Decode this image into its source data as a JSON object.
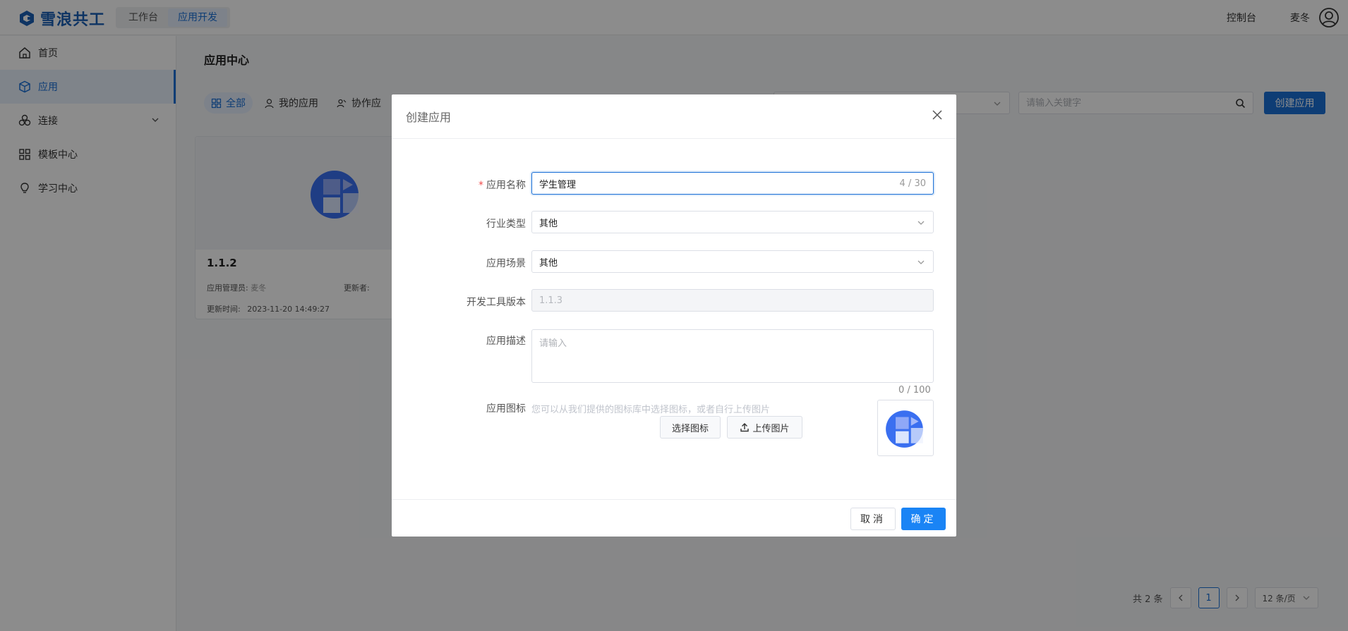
{
  "brand": {
    "name": "雪浪共工",
    "color": "#1a5fb4"
  },
  "topnav": [
    {
      "label": "工作台",
      "active": false
    },
    {
      "label": "应用开发",
      "active": true
    }
  ],
  "header": {
    "console": "控制台",
    "username": "麦冬"
  },
  "sidebar": {
    "items": [
      {
        "label": "首页",
        "icon": "home-icon"
      },
      {
        "label": "应用",
        "icon": "cube-icon",
        "active": true
      },
      {
        "label": "连接",
        "icon": "connect-icon",
        "expandable": true
      },
      {
        "label": "模板中心",
        "icon": "grid-icon"
      },
      {
        "label": "学习中心",
        "icon": "lightbulb-icon"
      }
    ]
  },
  "main": {
    "title": "应用中心",
    "tabs": [
      {
        "label": "全部",
        "active": true
      },
      {
        "label": "我的应用"
      },
      {
        "label": "协作应"
      }
    ],
    "search_placeholder": "请输入关键字",
    "create_button": "创建应用",
    "card": {
      "name": "1.1.2",
      "manager_label": "应用管理员:",
      "manager_value": "麦冬",
      "updater_label": "更新者:",
      "updated_label": "更新时间:",
      "updated_value": "2023-11-20 14:49:27"
    },
    "pagination": {
      "total": "共 2 条",
      "current": "1",
      "page_size": "12 条/页"
    }
  },
  "modal": {
    "title": "创建应用",
    "fields": {
      "name_label": "应用名称",
      "name_value": "学生管理",
      "name_count": "4 / 30",
      "industry_label": "行业类型",
      "industry_value": "其他",
      "scene_label": "应用场景",
      "scene_value": "其他",
      "version_label": "开发工具版本",
      "version_value": "1.1.3",
      "desc_label": "应用描述",
      "desc_placeholder": "请输入",
      "desc_count": "0 / 100",
      "icon_label": "应用图标",
      "icon_hint": "您可以从我们提供的图标库中选择图标，或者自行上传图片",
      "choose_icon": "选择图标",
      "upload_image": "上传图片"
    },
    "cancel": "取消",
    "confirm": "确定",
    "accent": "#1a84f5"
  }
}
